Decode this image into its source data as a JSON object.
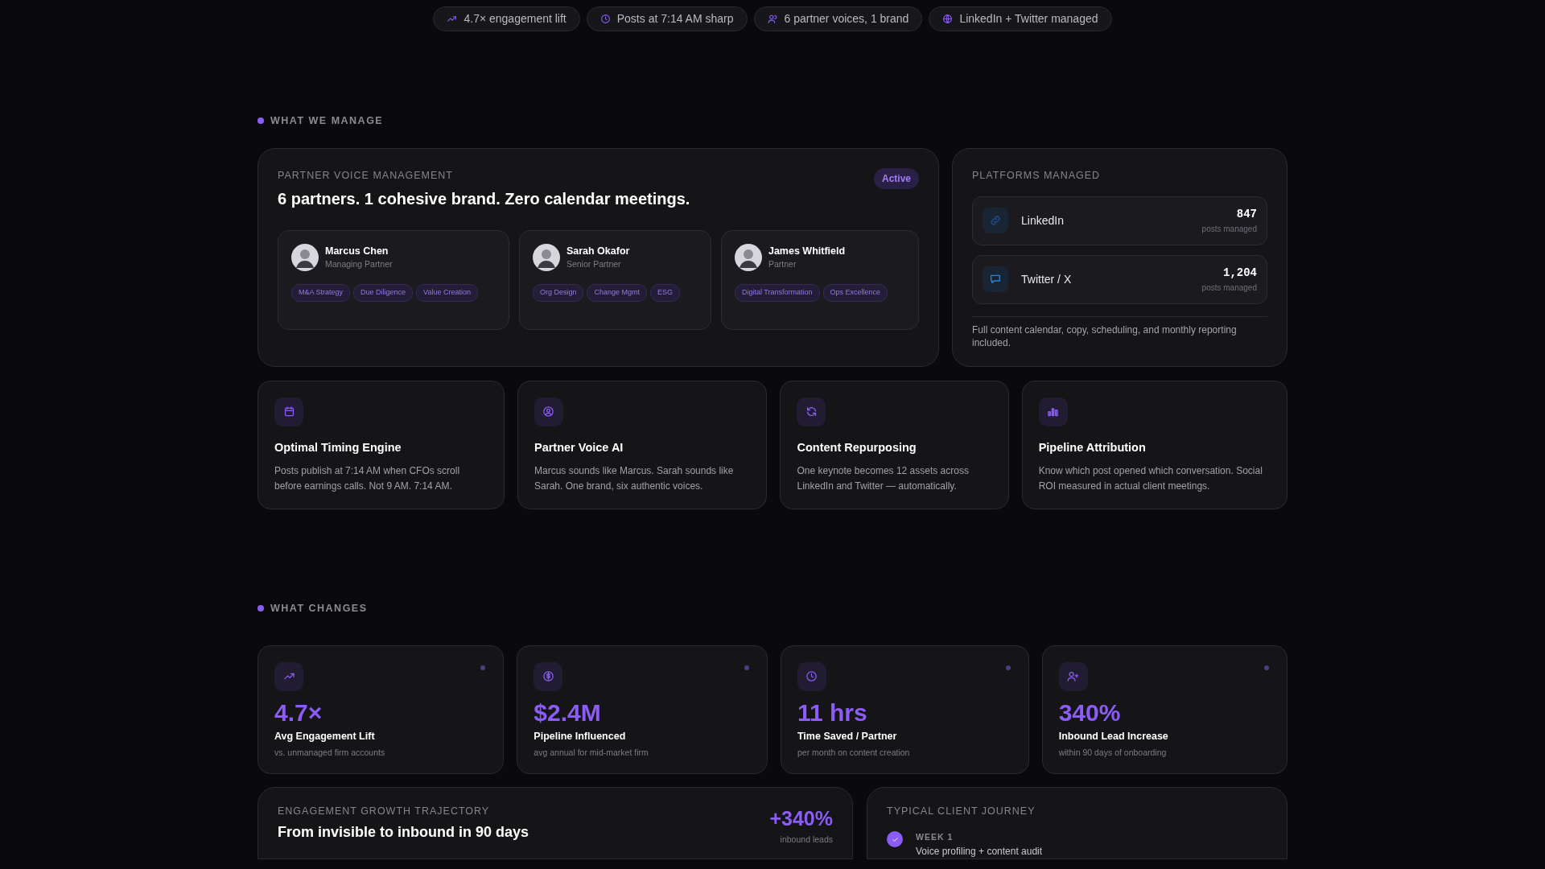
{
  "hero_chips": [
    {
      "text": "4.7× engagement lift"
    },
    {
      "text": "Posts at 7:14 AM sharp"
    },
    {
      "text": "6 partner voices, 1 brand"
    },
    {
      "text": "LinkedIn + Twitter managed"
    }
  ],
  "manage": {
    "label": "WHAT WE MANAGE",
    "partner_card": {
      "eyebrow": "PARTNER VOICE MANAGEMENT",
      "title": "6 partners. 1 cohesive brand. Zero calendar meetings.",
      "badge": "Active",
      "partners": [
        {
          "name": "Marcus Chen",
          "role": "Managing Partner",
          "tags": [
            "M&A Strategy",
            "Due Diligence",
            "Value Creation"
          ]
        },
        {
          "name": "Sarah Okafor",
          "role": "Senior Partner",
          "tags": [
            "Org Design",
            "Change Mgmt",
            "ESG"
          ]
        },
        {
          "name": "James Whitfield",
          "role": "Partner",
          "tags": [
            "Digital Transformation",
            "Ops Excellence"
          ]
        }
      ]
    },
    "platforms_card": {
      "eyebrow": "PLATFORMS MANAGED",
      "platforms": [
        {
          "name": "LinkedIn",
          "count": "847",
          "caption": "posts managed"
        },
        {
          "name": "Twitter / X",
          "count": "1,204",
          "caption": "posts managed"
        }
      ],
      "note": "Full content calendar, copy, scheduling, and monthly reporting included."
    },
    "features": [
      {
        "title": "Optimal Timing Engine",
        "text": "Posts publish at 7:14 AM when CFOs scroll before earnings calls. Not 9 AM. 7:14 AM."
      },
      {
        "title": "Partner Voice AI",
        "text": "Marcus sounds like Marcus. Sarah sounds like Sarah. One brand, six authentic voices."
      },
      {
        "title": "Content Repurposing",
        "text": "One keynote becomes 12 assets across LinkedIn and Twitter — automatically."
      },
      {
        "title": "Pipeline Attribution",
        "text": "Know which post opened which conversation. Social ROI measured in actual client meetings."
      }
    ]
  },
  "changes": {
    "label": "WHAT CHANGES",
    "stats": [
      {
        "value": "4.7×",
        "title": "Avg Engagement Lift",
        "caption": "vs. unmanaged firm accounts"
      },
      {
        "value": "$2.4M",
        "title": "Pipeline Influenced",
        "caption": "avg annual for mid-market firm"
      },
      {
        "value": "11 hrs",
        "title": "Time Saved / Partner",
        "caption": "per month on content creation"
      },
      {
        "value": "340%",
        "title": "Inbound Lead Increase",
        "caption": "within 90 days of onboarding"
      }
    ],
    "growth_card": {
      "eyebrow": "ENGAGEMENT GROWTH TRAJECTORY",
      "title": "From invisible to inbound in 90 days",
      "figure": "+340%",
      "figure_caption": "inbound leads"
    },
    "journey_card": {
      "eyebrow": "TYPICAL CLIENT JOURNEY",
      "steps": [
        {
          "week": "WEEK 1",
          "text": "Voice profiling + content audit",
          "done": true
        }
      ]
    }
  }
}
